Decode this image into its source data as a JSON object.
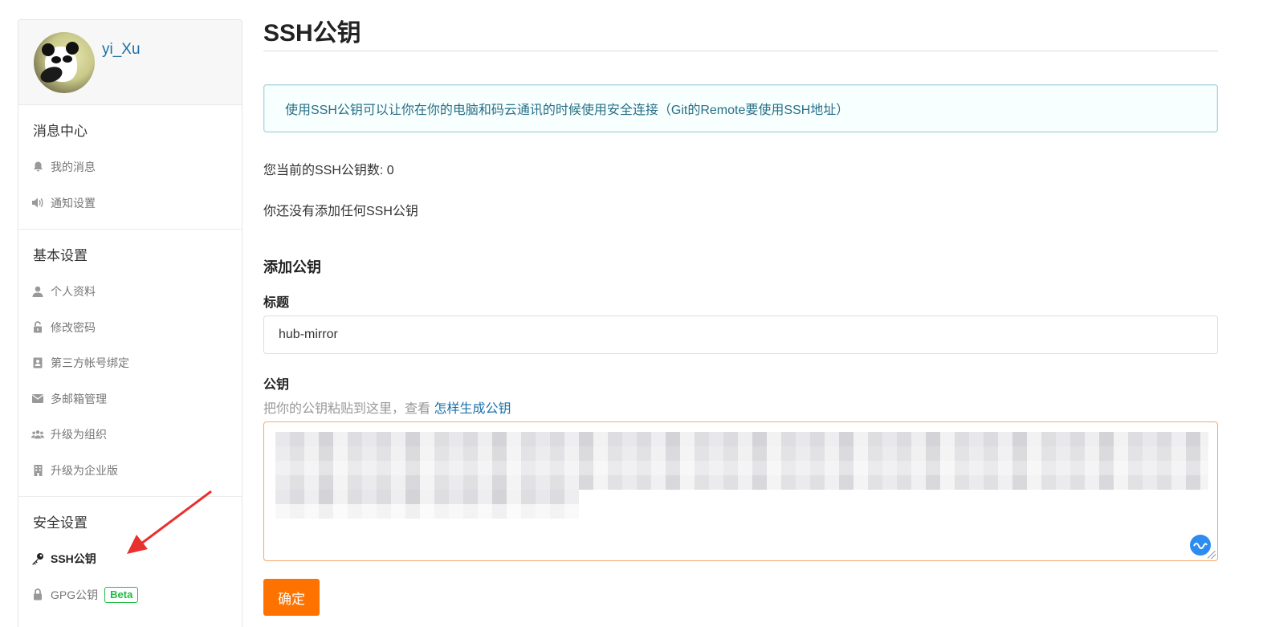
{
  "profile": {
    "username": "yi_Xu"
  },
  "sidebar": {
    "sections": [
      {
        "title": "消息中心",
        "items": [
          {
            "label": "我的消息",
            "icon": "bell-icon"
          },
          {
            "label": "通知设置",
            "icon": "volume-icon"
          }
        ]
      },
      {
        "title": "基本设置",
        "items": [
          {
            "label": "个人资料",
            "icon": "user-icon"
          },
          {
            "label": "修改密码",
            "icon": "unlock-icon"
          },
          {
            "label": "第三方帐号绑定",
            "icon": "address-book-icon"
          },
          {
            "label": "多邮箱管理",
            "icon": "mail-icon"
          },
          {
            "label": "升级为组织",
            "icon": "users-icon"
          },
          {
            "label": "升级为企业版",
            "icon": "building-icon"
          }
        ]
      },
      {
        "title": "安全设置",
        "items": [
          {
            "label": "SSH公钥",
            "icon": "key-icon",
            "active": true
          },
          {
            "label": "GPG公钥",
            "icon": "lock-icon",
            "badge": "Beta"
          }
        ]
      }
    ]
  },
  "main": {
    "title": "SSH公钥",
    "info_message": "使用SSH公钥可以让你在你的电脑和码云通讯的时候使用安全连接（Git的Remote要使用SSH地址）",
    "count_text": "您当前的SSH公钥数: 0",
    "empty_text": "你还没有添加任何SSH公钥",
    "add_title": "添加公钥",
    "title_label": "标题",
    "title_value": "hub-mirror",
    "key_label": "公钥",
    "key_hint": "把你的公钥粘贴到这里，查看 ",
    "key_hint_link": "怎样生成公钥",
    "submit_label": "确定"
  },
  "colors": {
    "accent": "#fe7300",
    "link": "#1b6fa8",
    "info_bg": "#f8ffff",
    "info_border": "#a9d5de",
    "badge": "#21ba45",
    "annotation_arrow": "#e8302f"
  }
}
